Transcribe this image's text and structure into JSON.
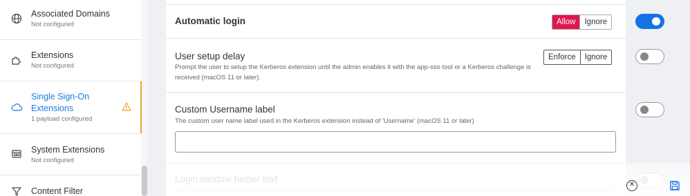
{
  "sidebar": {
    "items": [
      {
        "title": "Associated Domains",
        "sub": "Not configured",
        "icon": "globe-icon"
      },
      {
        "title": "Extensions",
        "sub": "Not configured",
        "icon": "puzzle-icon"
      },
      {
        "title": "Single Sign-On\nExtensions",
        "title1": "Single Sign-On",
        "title2": "Extensions",
        "sub": "1 payload configured",
        "icon": "cloud-icon",
        "warning_icon": "warning-icon"
      },
      {
        "title": "System Extensions",
        "sub": "Not configured",
        "icon": "extensions-icon"
      },
      {
        "title": "Content Filter",
        "sub": "",
        "icon": "filter-icon"
      }
    ]
  },
  "settings": {
    "automatic_login": {
      "title": "Automatic login",
      "options": [
        "Allow",
        "Ignore"
      ],
      "selected": "Allow",
      "enabled": true
    },
    "user_setup_delay": {
      "title": "User setup delay",
      "description": "Prompt the user to setup the Kerberos extension until the admin enables it with the app-sso tool or a Kerberos challenge is received (macOS 11 or later).",
      "options": [
        "Enforce",
        "Ignore"
      ],
      "enabled": false
    },
    "custom_username_label": {
      "title": "Custom Username label",
      "description": "The custom user name label used in the Kerberos extension instead of 'Username' (macOS 11 or later)",
      "value": "",
      "enabled": false
    },
    "login_window_helper_text": {
      "title": "Login window helper text",
      "enabled": false
    }
  },
  "colors": {
    "accent": "#1473e6",
    "allow_selected": "#e0164f",
    "active_item": "#1e7be0",
    "warning": "#f0a330"
  },
  "footer": {
    "close_icon": "close-circle-icon",
    "save_icon": "save-icon"
  }
}
